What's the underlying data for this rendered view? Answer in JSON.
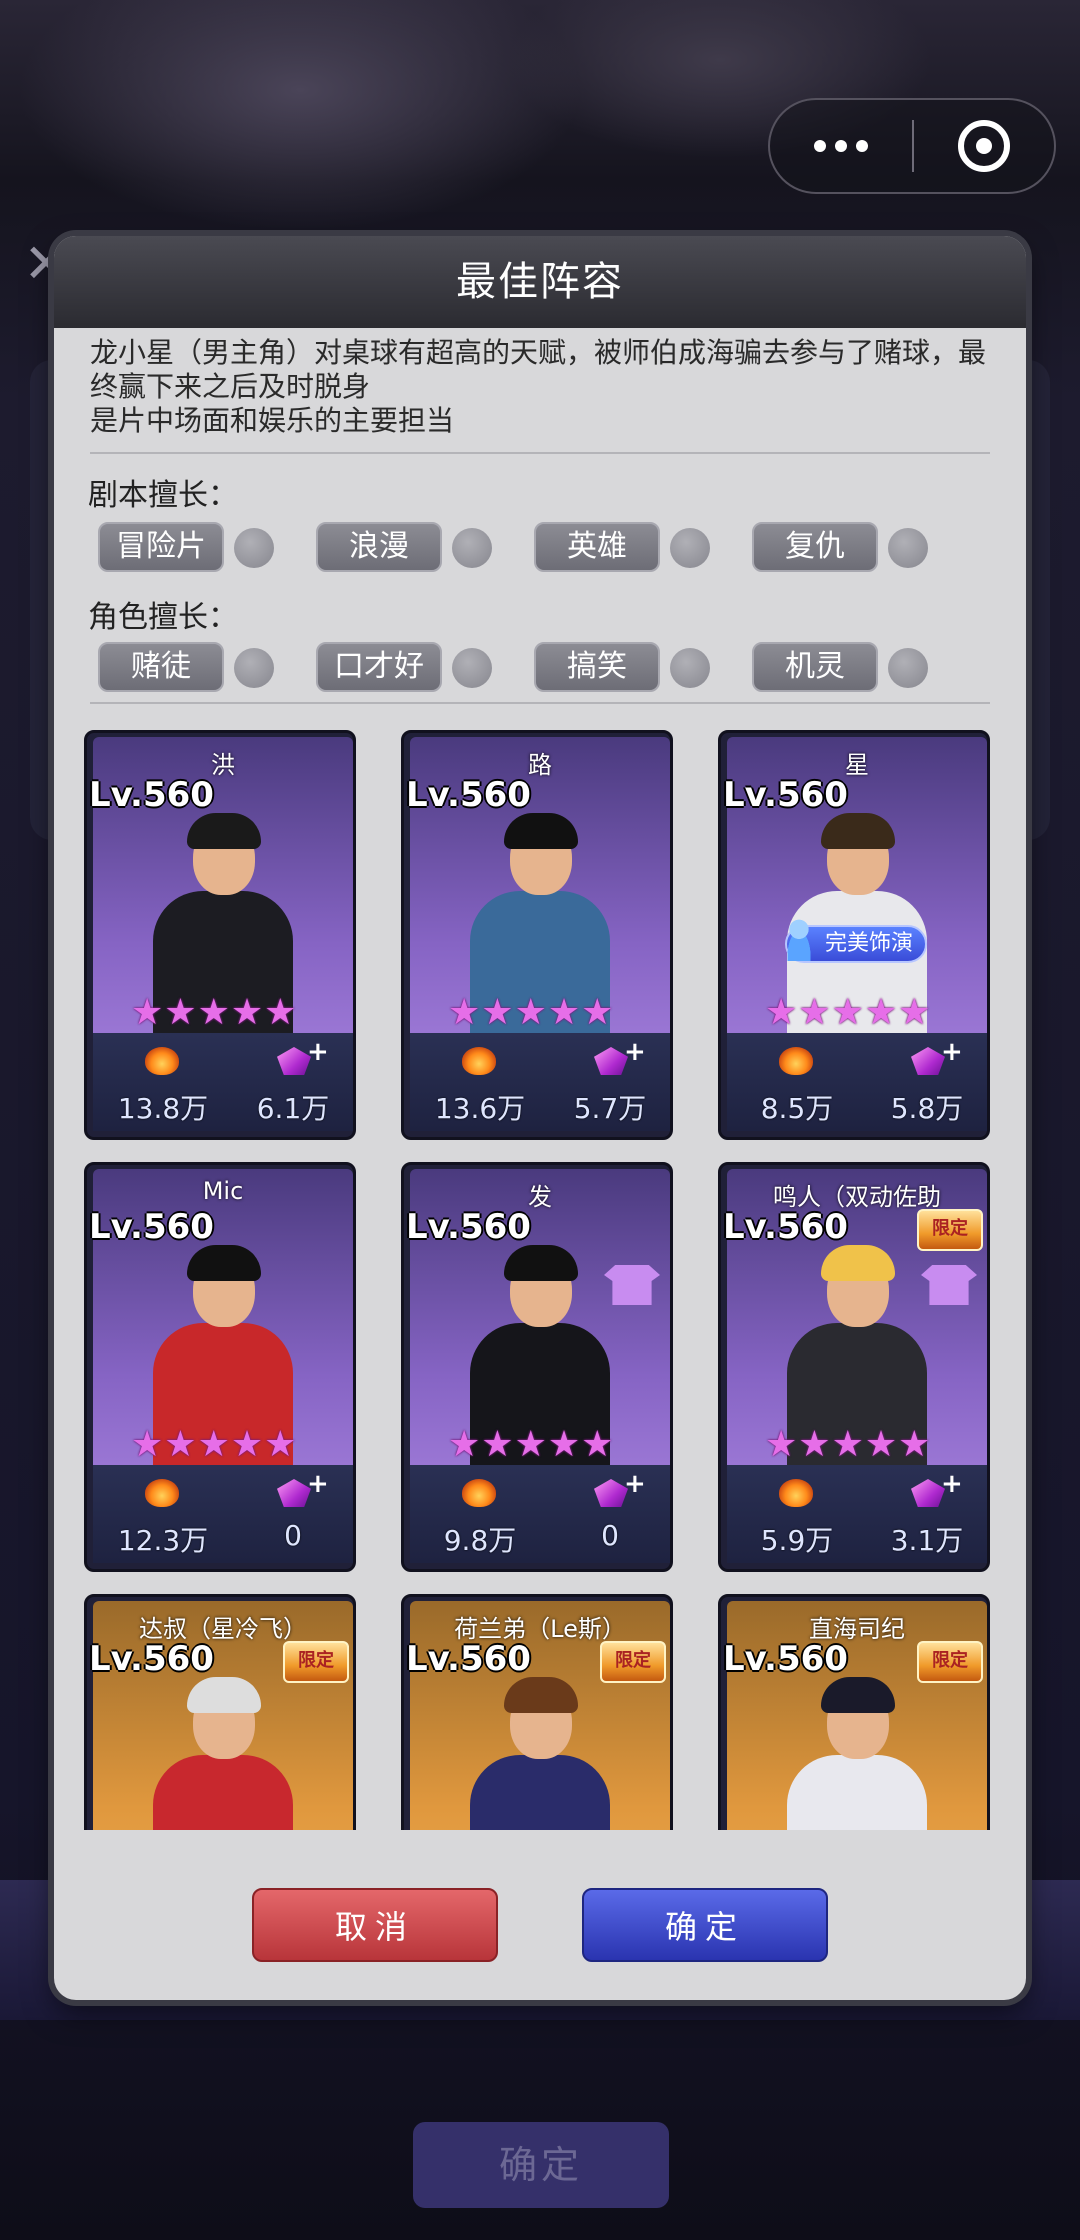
{
  "capsule": {
    "more_icon": "more-dots-icon",
    "close_icon": "target-icon"
  },
  "background": {
    "confirm_label": "确定"
  },
  "dialog": {
    "title": "最佳阵容",
    "description_line1": "龙小星（男主角）对桌球有超高的天赋，被师伯成海骗去参与了赌球，最",
    "description_line2": "终赢下来之后及时脱身",
    "description_line3": "是片中场面和娱乐的主要担当",
    "script_label": "剧本擅长：",
    "script_tags": [
      "冒险片",
      "浪漫",
      "英雄",
      "复仇"
    ],
    "role_label": "角色擅长：",
    "role_tags": [
      "赌徒",
      "口才好",
      "搞笑",
      "机灵"
    ],
    "cancel_label": "取消",
    "confirm_label": "确定"
  },
  "cards": [
    {
      "name": "洪",
      "level": "Lv.560",
      "stars": 5,
      "power": "13.8万",
      "gem": "6.1万",
      "bg": "purple"
    },
    {
      "name": "路",
      "level": "Lv.560",
      "stars": 5,
      "power": "13.6万",
      "gem": "5.7万",
      "bg": "purple"
    },
    {
      "name": "星",
      "level": "Lv.560",
      "stars": 5,
      "power": "8.5万",
      "gem": "5.8万",
      "bg": "purple",
      "badge": "完美饰演"
    },
    {
      "name": "Mic",
      "level": "Lv.560",
      "stars": 5,
      "power": "12.3万",
      "gem": "0",
      "bg": "purple"
    },
    {
      "name": "发",
      "level": "Lv.560",
      "stars": 5,
      "power": "9.8万",
      "gem": "0",
      "bg": "purple",
      "costume": true
    },
    {
      "name": "鸣人（双动佐助",
      "level": "Lv.560",
      "stars": 5,
      "power": "5.9万",
      "gem": "3.1万",
      "bg": "purple",
      "limited": "限定",
      "costume": true
    },
    {
      "name": "达叔（星冷飞）",
      "level": "Lv.560",
      "bg": "orange",
      "limited": "限定"
    },
    {
      "name": "荷兰弟（Le斯）",
      "level": "Lv.560",
      "bg": "orange",
      "limited": "限定"
    },
    {
      "name": "直海司纪",
      "level": "Lv.560",
      "bg": "orange",
      "limited": "限定"
    }
  ],
  "colors": {
    "accent_cancel": "#c9464a",
    "accent_confirm": "#3b46c8",
    "star": "#e66ee8"
  }
}
